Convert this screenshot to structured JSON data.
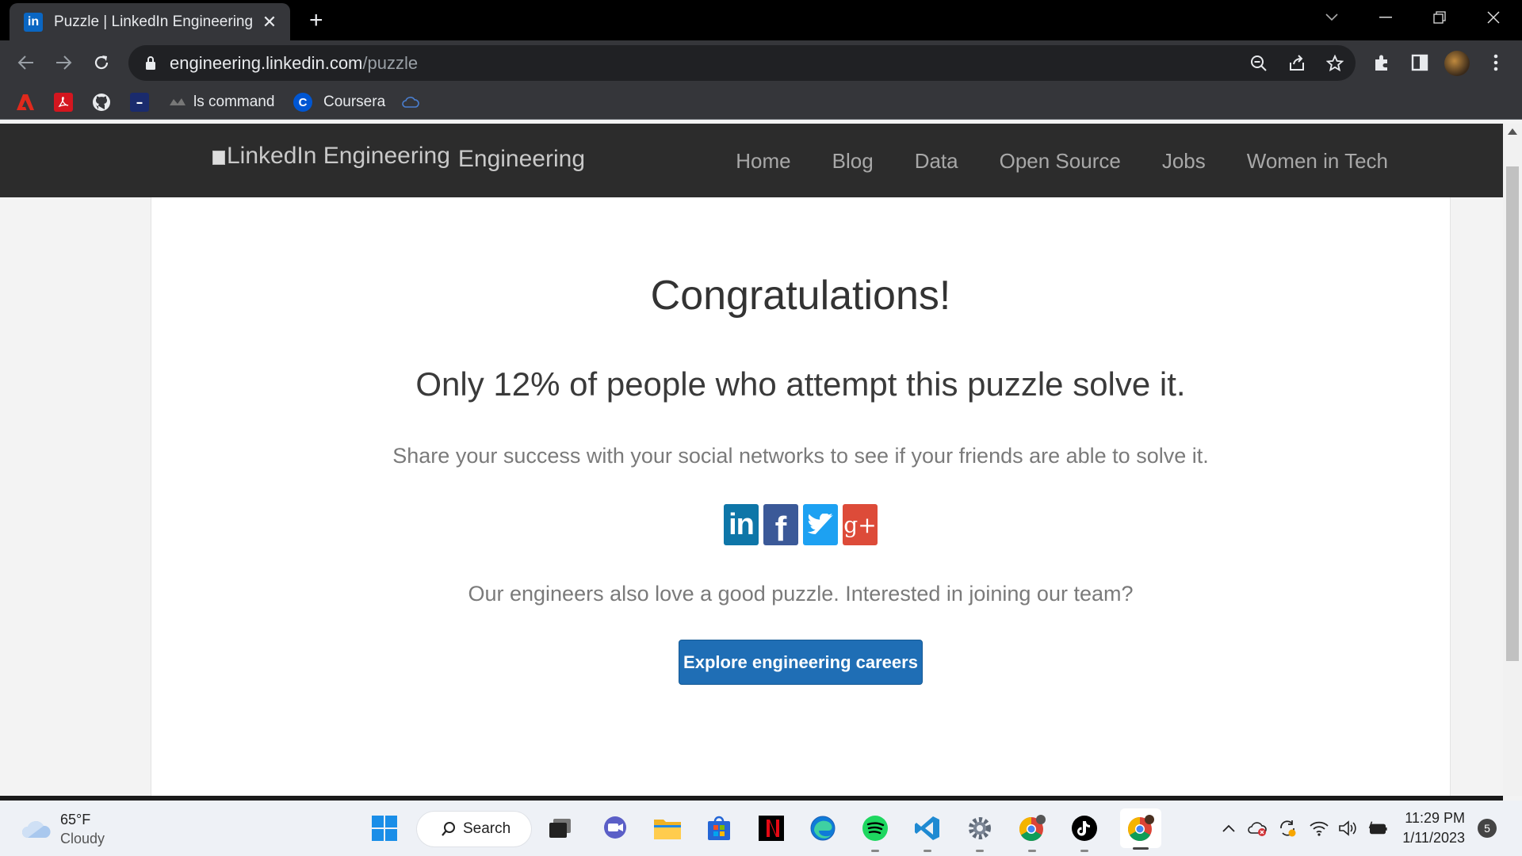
{
  "browser": {
    "tab_title": "Puzzle | LinkedIn Engineering",
    "tab_favicon": "in",
    "url_domain": "engineering.linkedin.com",
    "url_path": "/puzzle",
    "bookmarks": [
      {
        "label": "",
        "icon": "adobe-icon"
      },
      {
        "label": "",
        "icon": "pdf-icon"
      },
      {
        "label": "",
        "icon": "github-icon"
      },
      {
        "label": "",
        "icon": "bookmark-site-icon"
      },
      {
        "label": "ls command",
        "icon": "ls-command-icon"
      },
      {
        "label": "Coursera",
        "icon": "coursera-icon"
      },
      {
        "label": "",
        "icon": "cloud-bookmark-icon"
      }
    ]
  },
  "site": {
    "logo_alt": "LinkedIn Engineering",
    "logo_suffix": "Engineering",
    "nav": [
      "Home",
      "Blog",
      "Data",
      "Open Source",
      "Jobs",
      "Women in Tech"
    ]
  },
  "content": {
    "heading": "Congratulations!",
    "stat": "Only 12% of people who attempt this puzzle solve it.",
    "share_text": "Share your success with your social networks to see if your friends are able to solve it.",
    "social": [
      {
        "name": "linkedin",
        "glyph": "in",
        "color": "#0e76a8"
      },
      {
        "name": "facebook",
        "glyph": "f",
        "color": "#3b5998"
      },
      {
        "name": "twitter",
        "glyph": "t",
        "color": "#1da1f2"
      },
      {
        "name": "google-plus",
        "glyph": "g+",
        "color": "#dd4b39"
      }
    ],
    "team_text": "Our engineers also love a good puzzle. Interested in joining our team?",
    "cta_label": "Explore engineering careers"
  },
  "taskbar": {
    "temperature": "65°F",
    "condition": "Cloudy",
    "search_label": "Search",
    "time": "11:29 PM",
    "date": "1/11/2023",
    "notification_count": "5"
  }
}
